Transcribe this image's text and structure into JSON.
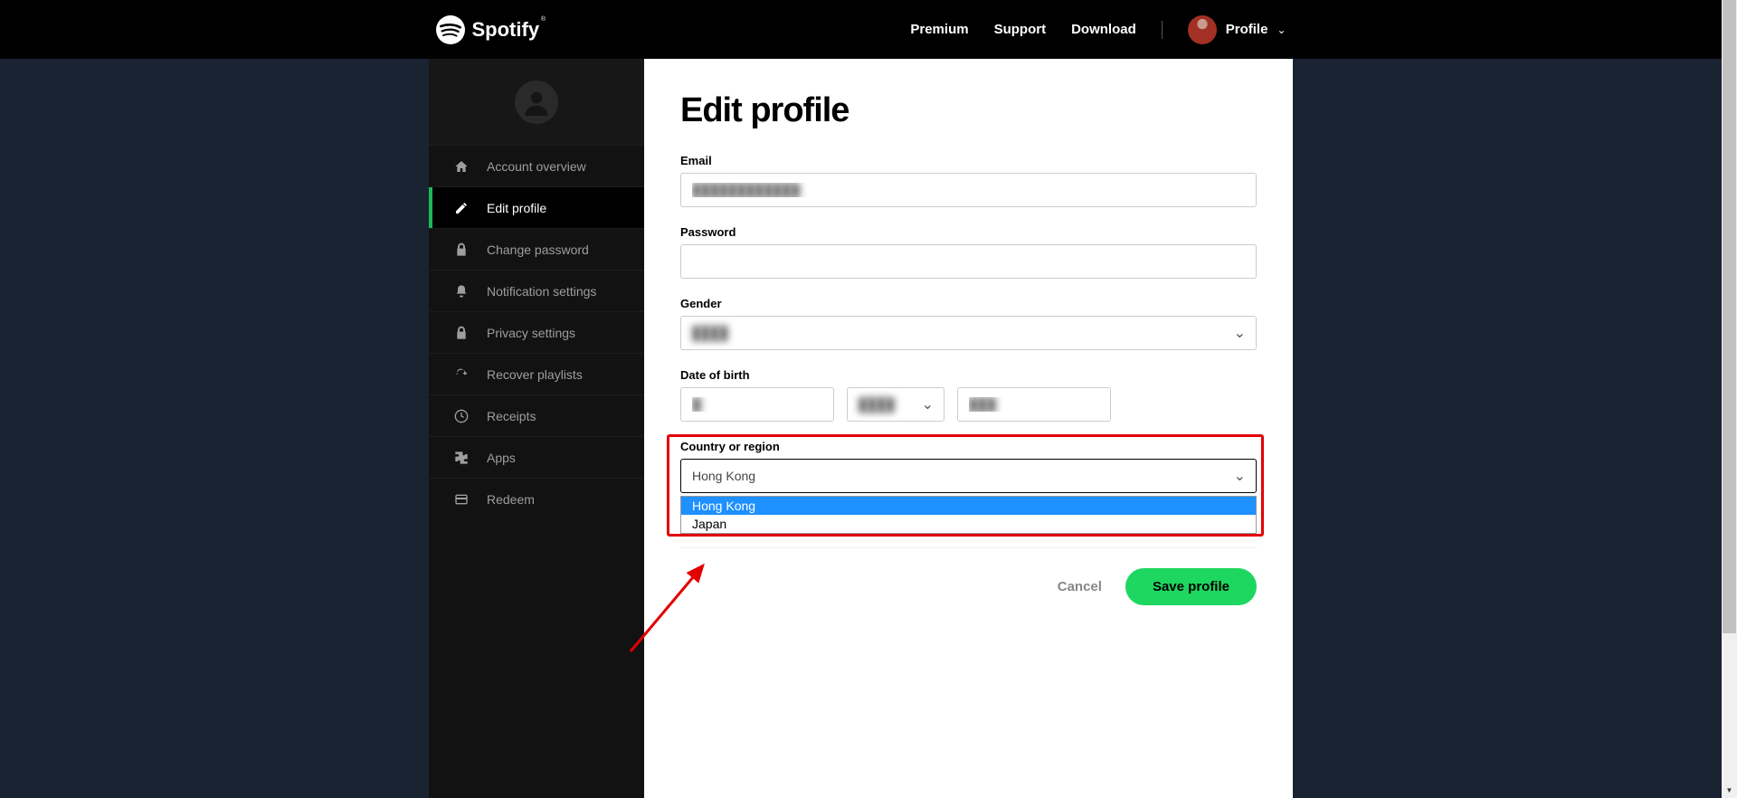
{
  "header": {
    "brand": "Spotify",
    "nav": {
      "premium": "Premium",
      "support": "Support",
      "download": "Download",
      "profile": "Profile"
    }
  },
  "sidebar": {
    "items": [
      {
        "id": "overview",
        "label": "Account overview"
      },
      {
        "id": "edit",
        "label": "Edit profile"
      },
      {
        "id": "password",
        "label": "Change password"
      },
      {
        "id": "notif",
        "label": "Notification settings"
      },
      {
        "id": "privacy",
        "label": "Privacy settings"
      },
      {
        "id": "recover",
        "label": "Recover playlists"
      },
      {
        "id": "receipts",
        "label": "Receipts"
      },
      {
        "id": "apps",
        "label": "Apps"
      },
      {
        "id": "redeem",
        "label": "Redeem"
      }
    ],
    "active_id": "edit"
  },
  "form": {
    "title": "Edit profile",
    "email": {
      "label": "Email",
      "value": "████████████"
    },
    "password": {
      "label": "Password",
      "value": ""
    },
    "gender": {
      "label": "Gender",
      "value": "████"
    },
    "dob": {
      "label": "Date of birth",
      "day": "█",
      "month": "████",
      "year": "███"
    },
    "country": {
      "label": "Country or region",
      "selected": "Hong Kong",
      "options": [
        "Hong Kong",
        "Japan"
      ],
      "highlighted_option": "Hong Kong"
    },
    "buttons": {
      "cancel": "Cancel",
      "save": "Save profile"
    }
  }
}
